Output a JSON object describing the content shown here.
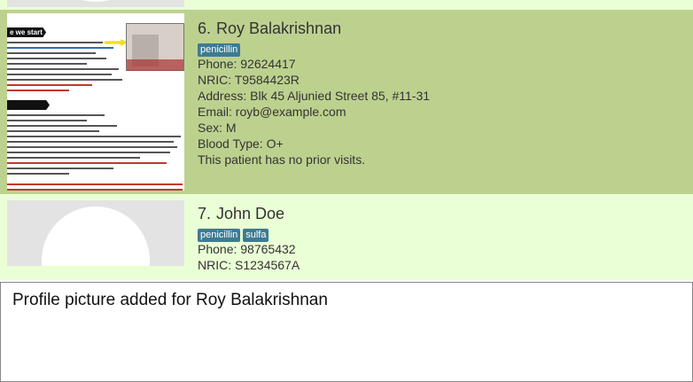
{
  "persons": [
    {
      "index": "6.",
      "name": "Roy Balakrishnan",
      "tags": [
        "penicillin"
      ],
      "phone": "Phone: 92624417",
      "nric": "NRIC: T9584423R",
      "address": "Address: Blk 45 Aljunied Street 85, #11-31",
      "email": "Email: royb@example.com",
      "sex": "Sex: M",
      "blood_type": "Blood Type: O+",
      "visits": "This patient has no prior visits.",
      "photo": "profile-picture-document"
    },
    {
      "index": "7.",
      "name": "John Doe",
      "tags": [
        "penicillin",
        "sulfa"
      ],
      "phone": "Phone: 98765432",
      "nric": "NRIC: S1234567A",
      "photo": "default-avatar-placeholder"
    }
  ],
  "result_display": {
    "message": "Profile picture added for Roy Balakrishnan"
  },
  "colors": {
    "list_background": "#eaffd5",
    "selected_card": "#bdd18f",
    "tag_background": "#3e7b91",
    "tag_text": "#ffffff"
  },
  "photo_document": {
    "banner_1": "e we start",
    "banner_2": " "
  }
}
